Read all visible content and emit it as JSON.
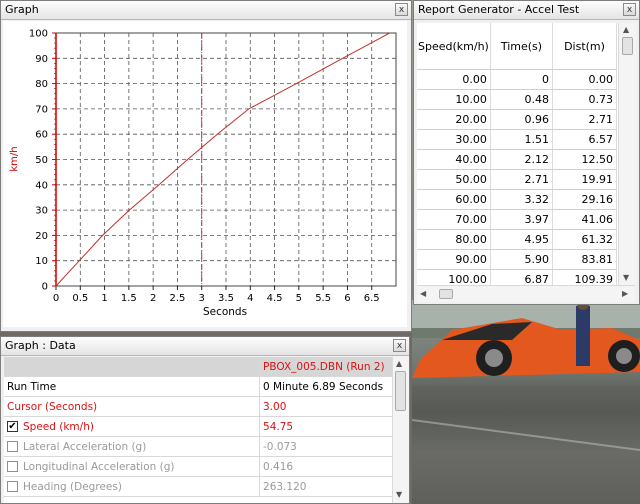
{
  "graph_window": {
    "title": "Graph",
    "close_glyph": "x"
  },
  "report_window": {
    "title": "Report Generator - Accel Test",
    "close_glyph": "x",
    "headers": [
      "Speed(km/h)",
      "Time(s)",
      "Dist(m)"
    ],
    "rows": [
      [
        "0.00",
        "0",
        "0.00"
      ],
      [
        "10.00",
        "0.48",
        "0.73"
      ],
      [
        "20.00",
        "0.96",
        "2.71"
      ],
      [
        "30.00",
        "1.51",
        "6.57"
      ],
      [
        "40.00",
        "2.12",
        "12.50"
      ],
      [
        "50.00",
        "2.71",
        "19.91"
      ],
      [
        "60.00",
        "3.32",
        "29.16"
      ],
      [
        "70.00",
        "3.97",
        "41.06"
      ],
      [
        "80.00",
        "4.95",
        "61.32"
      ],
      [
        "90.00",
        "5.90",
        "83.81"
      ],
      [
        "100.00",
        "6.87",
        "109.39"
      ]
    ]
  },
  "data_window": {
    "title": "Graph : Data",
    "close_glyph": "x",
    "run_header": "PBOX_005.DBN (Run 2)",
    "run_time_label": "Run Time",
    "run_time_value": "0 Minute 6.89 Seconds",
    "cursor_label": "Cursor (Seconds)",
    "cursor_value": "3.00",
    "channels": [
      {
        "label": "Speed (km/h)",
        "value": "54.75",
        "checked": true
      },
      {
        "label": "Lateral Acceleration (g)",
        "value": "-0.073",
        "checked": false
      },
      {
        "label": "Longitudinal Acceleration (g)",
        "value": "0.416",
        "checked": false
      },
      {
        "label": "Heading (Degrees)",
        "value": "263.120",
        "checked": false
      }
    ],
    "check_glyph": "✔"
  },
  "chart_data": {
    "type": "line",
    "xlabel": "Seconds",
    "ylabel": "km/h",
    "xlim": [
      0,
      7
    ],
    "ylim": [
      0,
      100
    ],
    "x_ticks": [
      "0",
      "0.5",
      "1",
      "1.5",
      "2",
      "2.5",
      "3",
      "3.5",
      "4",
      "4.5",
      "5",
      "5.5",
      "6",
      "6.5"
    ],
    "y_ticks": [
      "0",
      "10",
      "20",
      "30",
      "40",
      "50",
      "60",
      "70",
      "80",
      "90",
      "100"
    ],
    "cursor_x": 3.0,
    "grid": true,
    "line_color": "#c0302a",
    "axis_color": "#cc0000",
    "series": [
      {
        "x": [
          0,
          0.48,
          0.96,
          1.51,
          2.12,
          2.71,
          3.32,
          3.97,
          4.95,
          5.9,
          6.87
        ],
        "y": [
          0,
          10,
          20,
          30,
          40,
          50,
          60,
          70,
          80,
          90,
          100
        ]
      }
    ]
  }
}
